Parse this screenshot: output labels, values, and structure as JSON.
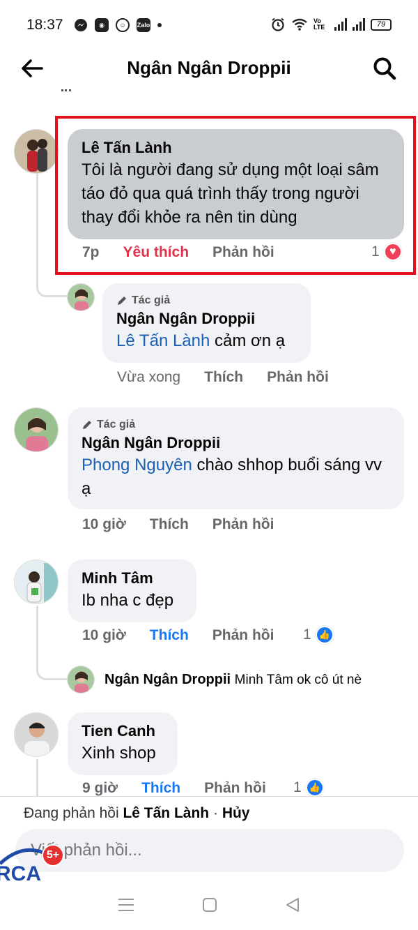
{
  "status_bar": {
    "time": "18:37",
    "battery": "79",
    "network_label": "Vo LTE",
    "app_icons": [
      "messenger-icon",
      "app-icon",
      "smile-icon",
      "zalo-icon"
    ]
  },
  "header": {
    "title": "Ngân Ngân Droppii"
  },
  "comments": [
    {
      "author": "Lê Tấn Lành",
      "text": "Tôi là người đang sử dụng một loại sâm táo đỏ qua quá trình thấy trong người thay đổi khỏe ra nên tin dùng",
      "time": "7p",
      "like_label": "Yêu thích",
      "reply_label": "Phản hồi",
      "reaction_count": "1"
    },
    {
      "badge": "Tác giả",
      "author": "Ngân Ngân Droppii",
      "mention": "Lê Tấn Lành",
      "text": " cảm ơn ạ",
      "time": "Vừa xong",
      "like_label": "Thích",
      "reply_label": "Phản hồi"
    },
    {
      "badge": "Tác giả",
      "author": "Ngân Ngân Droppii",
      "mention": "Phong Nguyên",
      "text": " chào shhop buổi sáng vv ạ",
      "time": "10 giờ",
      "like_label": "Thích",
      "reply_label": "Phản hồi"
    },
    {
      "author": "Minh Tâm",
      "text": "Ib nha c đẹp",
      "time": "10 giờ",
      "like_label": "Thích",
      "reply_label": "Phản hồi",
      "reaction_count": "1"
    },
    {
      "author": "Ngân Ngân Droppii",
      "text": "Minh Tâm ok cô út nè"
    },
    {
      "author": "Tien Canh",
      "text": "Xinh shop",
      "time": "9 giờ",
      "like_label": "Thích",
      "reply_label": "Phản hồi",
      "reaction_count": "1"
    }
  ],
  "reply_bar": {
    "prefix": "Đang phản hồi ",
    "target": "Lê Tấn Lành",
    "separator": " · ",
    "cancel": "Hủy",
    "placeholder": "Viết phản hồi..."
  },
  "overlay": {
    "badge": "5+"
  },
  "colors": {
    "highlight": "#e0121f",
    "love": "#e0324b",
    "like": "#1877f2",
    "mention": "#1a5fb4"
  }
}
